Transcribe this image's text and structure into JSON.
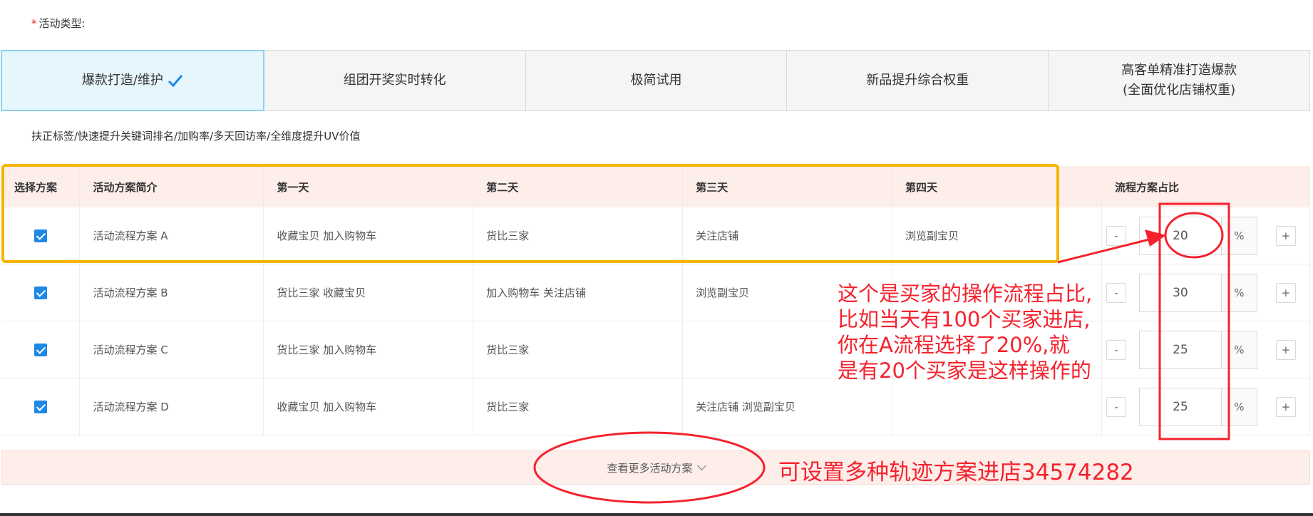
{
  "form": {
    "required_mark": "*",
    "activity_type_label": "活动类型:"
  },
  "tabs": [
    {
      "label": "爆款打造/维护",
      "active": true
    },
    {
      "label": "组团开奖实时转化",
      "active": false
    },
    {
      "label": "极简试用",
      "active": false
    },
    {
      "label": "新品提升综合权重",
      "active": false
    },
    {
      "label_line1": "高客单精准打造爆款",
      "label_line2": "(全面优化店铺权重)",
      "active": false
    }
  ],
  "tab_description": "扶正标签/快速提升关键词排名/加购率/多天回访率/全维度提升UV价值",
  "table": {
    "headers": {
      "select": "选择方案",
      "summary": "活动方案简介",
      "day1": "第一天",
      "day2": "第二天",
      "day3": "第三天",
      "day4": "第四天",
      "ratio": "流程方案占比"
    },
    "rows": [
      {
        "checked": true,
        "name": "活动流程方案 A",
        "day1": "收藏宝贝 加入购物车",
        "day2": "货比三家",
        "day3": "关注店铺",
        "day4": "浏览副宝贝",
        "ratio": "20"
      },
      {
        "checked": true,
        "name": "活动流程方案 B",
        "day1": "货比三家 收藏宝贝",
        "day2": "加入购物车 关注店铺",
        "day3": "浏览副宝贝",
        "day4": "",
        "ratio": "30"
      },
      {
        "checked": true,
        "name": "活动流程方案 C",
        "day1": "货比三家 加入购物车",
        "day2": "货比三家",
        "day3": "",
        "day4": "",
        "ratio": "25"
      },
      {
        "checked": true,
        "name": "活动流程方案 D",
        "day1": "收藏宝贝 加入购物车",
        "day2": "货比三家",
        "day3": "关注店铺 浏览副宝贝",
        "day4": "",
        "ratio": "25"
      }
    ],
    "minus_label": "-",
    "plus_label": "+",
    "percent_label": "%"
  },
  "more_button": {
    "label": "查看更多活动方案"
  },
  "annotations": {
    "ratio_note": [
      "这个是买家的操作流程占比,",
      "比如当天有100个买家进店,",
      "你在A流程选择了20%,就",
      "是有20个买家是这样操作的"
    ],
    "more_note": "可设置多种轨迹方案进店34574282"
  },
  "colors": {
    "accent": "#1e88e5",
    "annotation_red": "#f5222d",
    "highlight_yellow": "#f7b500",
    "header_bg": "#fdeeea",
    "active_tab_bg": "#e6f6fd"
  }
}
